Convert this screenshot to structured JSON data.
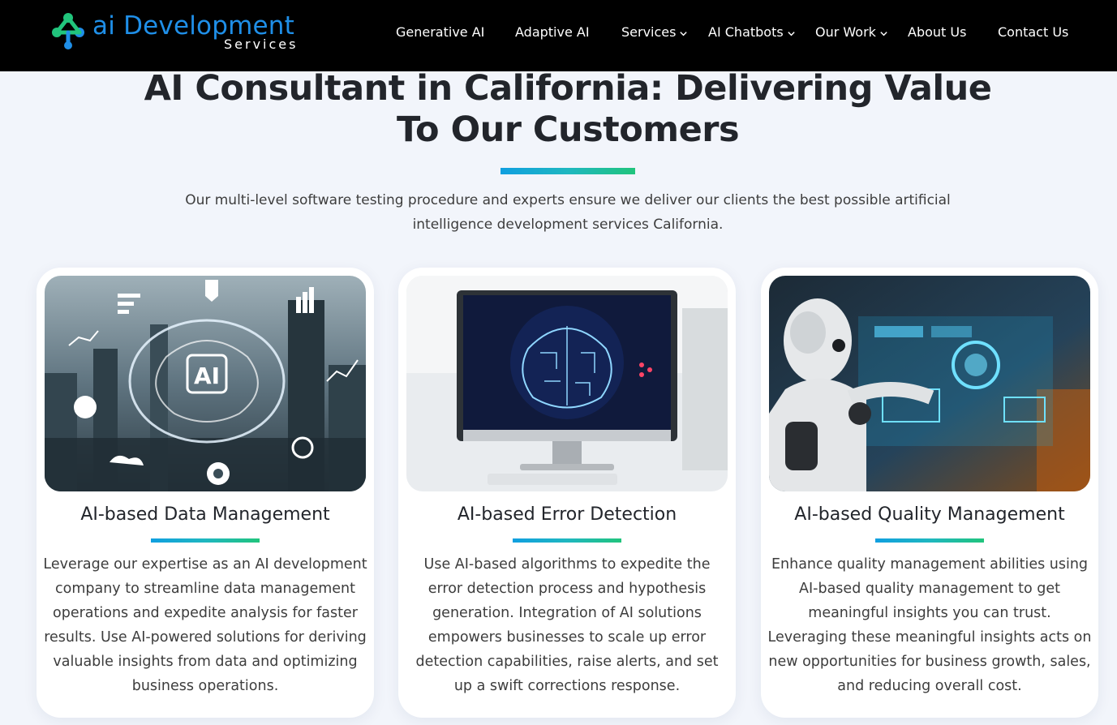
{
  "header": {
    "logo": {
      "main": "ai Development",
      "sub": "Services"
    },
    "nav": [
      {
        "label": "Generative AI",
        "dropdown": false
      },
      {
        "label": "Adaptive AI",
        "dropdown": false
      },
      {
        "label": "Services",
        "dropdown": true
      },
      {
        "label": "AI Chatbots",
        "dropdown": true
      },
      {
        "label": "Our Work",
        "dropdown": true
      },
      {
        "label": "About Us",
        "dropdown": false
      },
      {
        "label": "Contact Us",
        "dropdown": false
      }
    ]
  },
  "hero": {
    "title_line1": "AI Consultant in California: Delivering Value",
    "title_line2": "To Our Customers",
    "description_line1": "Our multi-level software testing procedure and experts ensure we deliver our clients the best possible artificial",
    "description_line2": "intelligence development services California."
  },
  "cards": [
    {
      "title": "AI-based Data Management",
      "image": "ai-brain-city-illustration",
      "body": "Leverage our expertise as an AI development company to streamline data management operations and expedite analysis for faster results. Use AI-powered solutions for deriving valuable insights from data and optimizing business operations."
    },
    {
      "title": "AI-based Error Detection",
      "image": "monitor-circuit-brain-illustration",
      "body": "Use AI-based algorithms to expedite the error detection process and hypothesis generation. Integration of AI solutions empowers businesses to scale up error detection capabilities, raise alerts, and set up a swift corrections response."
    },
    {
      "title": "AI-based Quality Management",
      "image": "robot-hologram-illustration",
      "body": "Enhance quality management abilities using AI-based quality management to get meaningful insights you can trust. Leveraging these meaningful insights acts on new opportunities for business growth, sales, and reducing overall cost."
    }
  ],
  "colors": {
    "brand_blue": "#1f8fe8",
    "brand_green": "#21c47c",
    "header_bg": "#000000",
    "page_bg": "#f2f5fb"
  }
}
